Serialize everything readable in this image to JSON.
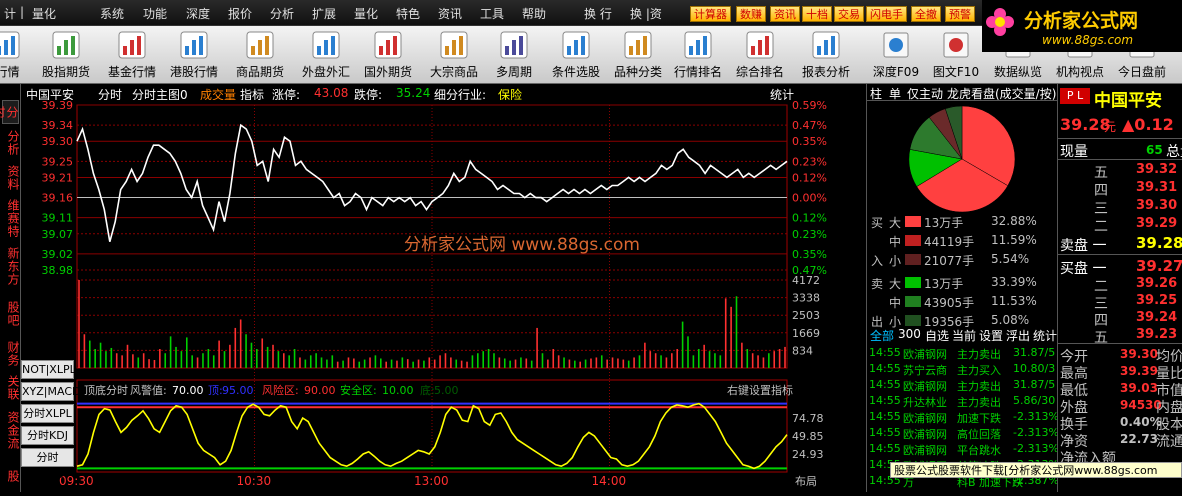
{
  "menu": {
    "left": [
      "计",
      "量化"
    ],
    "items": [
      "系统",
      "功能",
      "深度",
      "报价",
      "分析",
      "扩展",
      "量化",
      "特色",
      "资讯",
      "工具",
      "帮助"
    ],
    "right": [
      "换 行",
      "换 |资"
    ],
    "tags": [
      "计算器",
      "数赚",
      "资讯",
      "十档",
      "交易",
      "闪电手",
      "全撤",
      "预警"
    ]
  },
  "logo": {
    "text": "分析家公式网",
    "url": "www.88gs.com"
  },
  "toolbar": {
    "left": [
      {
        "label": "i行情",
        "icon": "chart-grid-icon"
      },
      {
        "label": "股指期货",
        "icon": "magnifier-icon"
      },
      {
        "label": "基金行情",
        "icon": "line-chart-icon"
      },
      {
        "label": "港股行情",
        "icon": "flower-icon"
      },
      {
        "label": "商品期货",
        "icon": "gold-bars-icon"
      },
      {
        "label": "外盘外汇",
        "icon": "globe-chart-icon"
      },
      {
        "label": "国外期货",
        "icon": "rising-chart-icon"
      },
      {
        "label": "大宗商品",
        "icon": "stacks-icon"
      },
      {
        "label": "多周期",
        "icon": "grid-icon"
      },
      {
        "label": "条件选股",
        "icon": "target-icon"
      },
      {
        "label": "品种分类",
        "icon": "categories-icon"
      },
      {
        "label": "行情排名",
        "icon": "ranking-icon"
      },
      {
        "label": "综合排名",
        "icon": "bars-ranking-icon"
      },
      {
        "label": "报表分析",
        "icon": "report-icon"
      }
    ],
    "right": [
      {
        "label": "深度F09",
        "icon": "depth-icon"
      },
      {
        "label": "图文F10",
        "icon": "f10-icon"
      },
      {
        "label": "数据纵览",
        "icon": "data-icon"
      },
      {
        "label": "机构视点",
        "icon": "institution-icon"
      },
      {
        "label": "今日盘前",
        "icon": "today-icon"
      }
    ]
  },
  "left_tabs": [
    "分时",
    "分析",
    "资料",
    "维赛特",
    "新东方",
    "股吧",
    "财务",
    "关联",
    "资金流",
    "股"
  ],
  "header": {
    "name": "中国平安",
    "mode": "分时",
    "main_chart": "分时主图0",
    "trade_label": "成交量",
    "indicator": "指标",
    "up_label": "涨停:",
    "up_value": "43.08",
    "down_label": "跌停:",
    "down_value": "35.24",
    "sector_label": "细分行业:",
    "sector": "保险",
    "stat": "统计"
  },
  "watermark": "分析家公式网 www.88gs.com",
  "chart_data": {
    "type": "line",
    "price_ticks": [
      "39.39",
      "39.34",
      "39.30",
      "39.25",
      "39.21",
      "39.16",
      "39.11",
      "39.07",
      "39.02",
      "38.98"
    ],
    "pct_ticks": [
      "0.59%",
      "0.47%",
      "0.35%",
      "0.23%",
      "0.12%",
      "0.00%",
      "0.12%",
      "0.23%",
      "0.35%",
      "0.47%"
    ],
    "vol_ticks": [
      "4172",
      "3338",
      "2503",
      "1669",
      "834"
    ],
    "ind_ticks": [
      "74.78",
      "49.85",
      "24.93"
    ],
    "time_labels": [
      "09:30",
      "10:30",
      "13:00",
      "14:00"
    ],
    "prev_close": 39.16,
    "ylim": [
      38.98,
      39.39
    ],
    "price": [
      39.3,
      39.33,
      39.28,
      39.22,
      39.18,
      39.13,
      39.05,
      39.1,
      39.18,
      39.2,
      39.23,
      39.2,
      39.22,
      39.26,
      39.29,
      39.29,
      39.28,
      39.27,
      39.25,
      39.22,
      39.18,
      39.16,
      39.2,
      39.14,
      39.11,
      39.08,
      39.15,
      39.1,
      39.17,
      39.27,
      39.34,
      39.33,
      39.3,
      39.24,
      39.25,
      39.2,
      39.28,
      39.26,
      39.31,
      39.3,
      39.24,
      39.25,
      39.23,
      39.22,
      39.21,
      39.2,
      39.18,
      39.16,
      39.17,
      39.14,
      39.15,
      39.17,
      39.16,
      39.13,
      39.16,
      39.15,
      39.14,
      39.16,
      39.15,
      39.16,
      39.15,
      39.16,
      39.14,
      39.15,
      39.13,
      39.15,
      39.16,
      39.17,
      39.19,
      39.22,
      39.2,
      39.21,
      39.25,
      39.23,
      39.22,
      39.21,
      39.2,
      39.18,
      39.19,
      39.18,
      39.17,
      39.17,
      39.16,
      39.17,
      39.16,
      39.16,
      39.15,
      39.16,
      39.17,
      39.18,
      39.17,
      39.18,
      39.17,
      39.18,
      39.17,
      39.18,
      39.19,
      39.18,
      39.19,
      39.19,
      39.2,
      39.21,
      39.2,
      39.21,
      39.2,
      39.21,
      39.22,
      39.24,
      39.23,
      39.24,
      39.27,
      39.28,
      39.26,
      39.25,
      39.24,
      39.22,
      39.24,
      39.23,
      39.22,
      39.21,
      39.22,
      39.23,
      39.21,
      39.22,
      39.21,
      39.22,
      39.23,
      39.24,
      39.23,
      39.24,
      39.25
    ],
    "volume": [
      4172,
      1600,
      1300,
      900,
      1200,
      800,
      950,
      700,
      600,
      1100,
      650,
      500,
      700,
      420,
      380,
      900,
      700,
      1500,
      1000,
      800,
      1450,
      600,
      500,
      700,
      900,
      600,
      1300,
      800,
      1100,
      1900,
      2300,
      1600,
      1200,
      900,
      1400,
      1000,
      1100,
      800,
      700,
      600,
      900,
      500,
      400,
      600,
      700,
      500,
      400,
      600,
      300,
      350,
      500,
      450,
      300,
      400,
      500,
      600,
      450,
      300,
      400,
      350,
      500,
      420,
      300,
      400,
      350,
      500,
      400,
      600,
      700,
      500,
      400,
      350,
      300,
      600,
      700,
      800,
      900,
      700,
      500,
      450,
      350,
      400,
      500,
      450,
      350,
      1900,
      700,
      400,
      900,
      600,
      500,
      400,
      350,
      300,
      400,
      450,
      500,
      600,
      400,
      500,
      450,
      400,
      350,
      500,
      600,
      1200,
      800,
      700,
      600,
      500,
      700,
      900,
      2200,
      1500,
      600,
      900,
      1100,
      800,
      700,
      600,
      3300,
      2900,
      3400,
      1200,
      900,
      700,
      600,
      500,
      700,
      800,
      900,
      1000
    ],
    "ind_labels": {
      "name": "顶底分时",
      "warn": "风警值:",
      "warn_val": "70.00",
      "top": "顶:",
      "top_val": "95.00",
      "risk": "风险区:",
      "risk_val": "90.00",
      "safe": "安全区:",
      "safe_val": "10.00",
      "bottom": "底:",
      "bottom_val": "5.00",
      "right_hint": "右键设置指标",
      "layout": "布局"
    },
    "ind_buttons": [
      "NOT|XLPL",
      "XYZ|MACD",
      "分时XLPL",
      "分时KDJ",
      "分时MACD"
    ],
    "indicator": [
      8,
      10,
      25,
      55,
      80,
      88,
      86,
      70,
      55,
      62,
      72,
      78,
      85,
      74,
      60,
      55,
      70,
      85,
      92,
      90,
      80,
      60,
      40,
      30,
      25,
      20,
      10,
      15,
      30,
      55,
      78,
      90,
      94,
      90,
      80,
      78,
      86,
      92,
      90,
      70,
      60,
      75,
      70,
      55,
      40,
      30,
      20,
      15,
      10,
      8,
      12,
      18,
      25,
      28,
      22,
      15,
      10,
      8,
      12,
      15,
      20,
      25,
      30,
      28,
      25,
      35,
      55,
      80,
      90,
      86,
      72,
      70,
      92,
      88,
      70,
      65,
      80,
      82,
      70,
      55,
      45,
      40,
      35,
      30,
      25,
      20,
      15,
      10,
      8,
      12,
      20,
      35,
      48,
      55,
      50,
      40,
      30,
      20,
      18,
      10,
      8,
      10,
      15,
      25,
      35,
      50,
      70,
      82,
      90,
      93,
      92,
      90,
      93,
      95,
      90,
      80,
      70,
      55,
      40,
      30,
      20,
      10,
      8,
      5,
      8,
      15,
      25,
      35,
      42,
      52
    ]
  },
  "pie": {
    "values": [
      33.4,
      32.9,
      11.6,
      11.5,
      5.5,
      5.1
    ],
    "colors": [
      "#ff4040",
      "#ff4040",
      "#00c000",
      "#2d7a2d",
      "#6a2a2a",
      "#2a5a2a"
    ]
  },
  "flows": [
    {
      "side": "买",
      "sub": "大",
      "value": "13万手",
      "pct": "32.88%",
      "color": "#ff4040"
    },
    {
      "side": "",
      "sub": "中",
      "value": "44119手",
      "pct": "11.59%",
      "color": "#c02020"
    },
    {
      "side": "入",
      "sub": "小",
      "value": "21077手",
      "pct": "5.54%",
      "color": "#602020"
    },
    {
      "side": "卖",
      "sub": "大",
      "value": "13万手",
      "pct": "33.39%",
      "color": "#00c000"
    },
    {
      "side": "",
      "sub": "中",
      "value": "43905手",
      "pct": "11.53%",
      "color": "#208020"
    },
    {
      "side": "出",
      "sub": "小",
      "value": "19356手",
      "pct": "5.08%",
      "color": "#205020"
    }
  ],
  "rp1_tabs": [
    "柱",
    "单",
    "仅主动",
    "龙虎看盘(成交量/按)"
  ],
  "filters": [
    "全部",
    "300",
    "自选",
    "当前",
    "设置",
    "浮出",
    "统计"
  ],
  "trades": [
    {
      "time": "14:55",
      "name": "欧浦钢网",
      "action": "主力卖出",
      "val": "31.87/5"
    },
    {
      "time": "14:55",
      "name": "苏宁云商",
      "action": "主力买入",
      "val": "10.80/3"
    },
    {
      "time": "14:55",
      "name": "欧浦钢网",
      "action": "主力卖出",
      "val": "31.87/5"
    },
    {
      "time": "14:55",
      "name": "升达林业",
      "action": "主力卖出",
      "val": "5.86/30"
    },
    {
      "time": "14:55",
      "name": "欧浦钢网",
      "action": "加速下跌",
      "val": "-2.313%"
    },
    {
      "time": "14:55",
      "name": "欧浦钢网",
      "action": "高位回落",
      "val": "-2.313%"
    },
    {
      "time": "14:55",
      "name": "欧浦钢网",
      "action": "平台跳水",
      "val": "-2.313%"
    },
    {
      "time": "14:55",
      "name": "欧浦钢网",
      "action": "单笔冲跌",
      "val": "-2.313%"
    },
    {
      "time": "14:55",
      "name": "万",
      "action": "科B 加速下跌",
      "val": "-2.387%"
    }
  ],
  "ad": "股票公式股票软件下载[分析家公式网www.88gs.com",
  "quote": {
    "code": "P L",
    "name": "中国平安",
    "price": "39.28",
    "unit": "元",
    "change": "▲0.12",
    "now_label": "现量",
    "now_val": "65",
    "total_label": "总量",
    "asks": [
      {
        "label": "五",
        "val": "39.32"
      },
      {
        "label": "四",
        "val": "39.31"
      },
      {
        "label": "三",
        "val": "39.30"
      },
      {
        "label": "二",
        "val": "39.29"
      }
    ],
    "ask1_label": "卖盘 一",
    "ask1": "39.28",
    "bid1_label": "买盘 一",
    "bid1": "39.27",
    "bids": [
      {
        "label": "二",
        "val": "39.26"
      },
      {
        "label": "三",
        "val": "39.25"
      },
      {
        "label": "四",
        "val": "39.24"
      },
      {
        "label": "五",
        "val": "39.23"
      }
    ],
    "stats": [
      {
        "l": "今开",
        "v": "39.30",
        "r": "均价"
      },
      {
        "l": "最高",
        "v": "39.39",
        "r": "量比"
      },
      {
        "l": "最低",
        "v": "39.03",
        "r": "市值"
      },
      {
        "l": "外盘",
        "v": "94530",
        "r": "内盘"
      },
      {
        "l": "换手",
        "v": "0.40%",
        "r": "股本"
      },
      {
        "l": "净资",
        "v": "22.73",
        "r": "流通"
      },
      {
        "l": "净流入额",
        "v": "",
        "r": ""
      }
    ]
  }
}
